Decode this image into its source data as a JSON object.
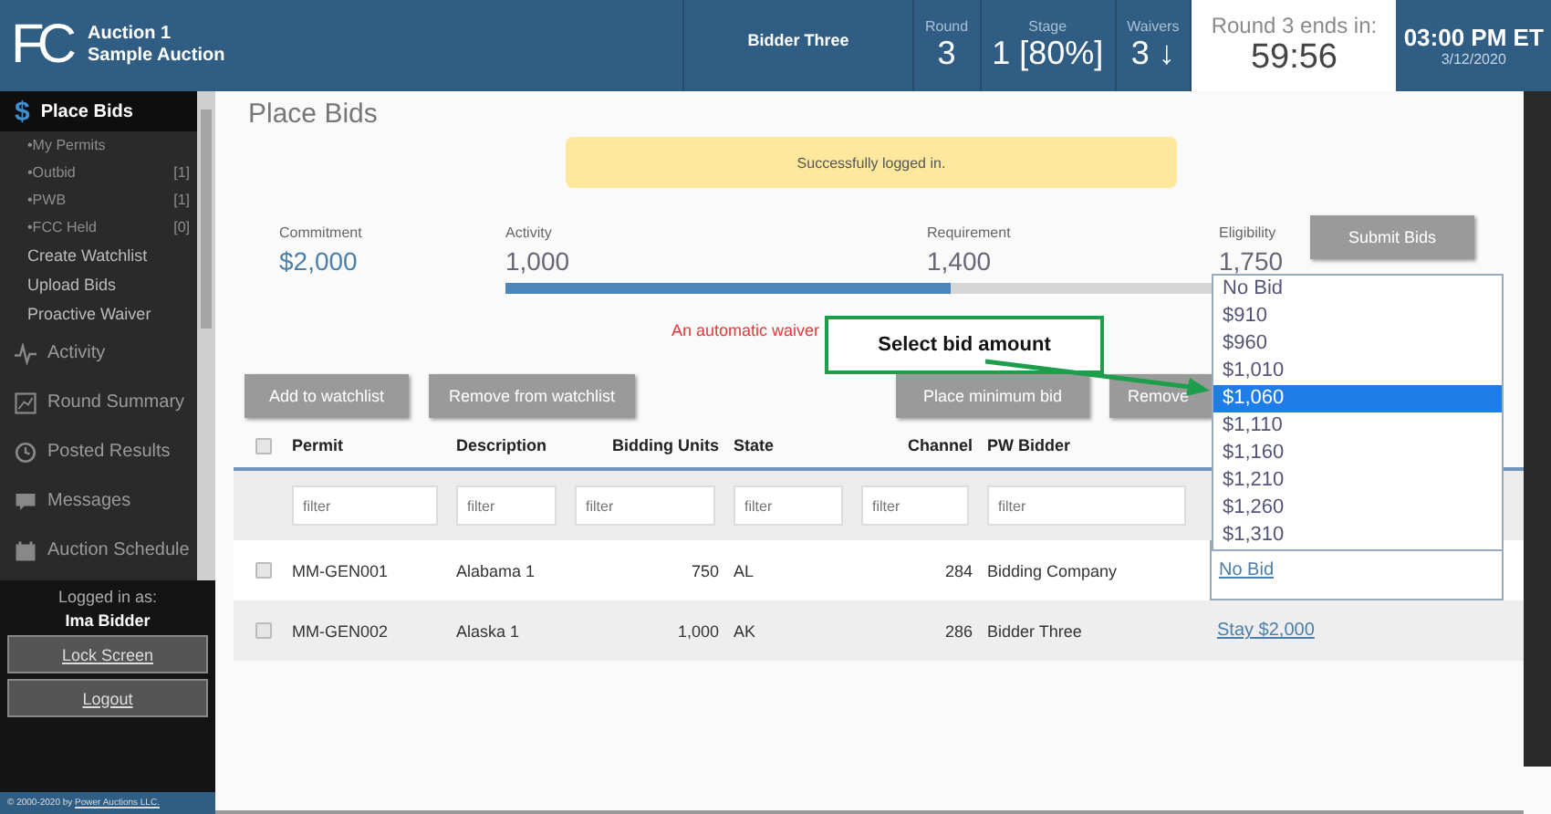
{
  "header": {
    "logo": "FC",
    "auction": "Auction 1",
    "auction_name": "Sample Auction",
    "bidder": "Bidder Three",
    "stats": [
      {
        "label": "Round",
        "value": "3"
      },
      {
        "label": "Stage",
        "value": "1 [80%]"
      },
      {
        "label": "Waivers",
        "value": "3 ↓"
      }
    ],
    "countdown": {
      "label": "Round 3 ends in:",
      "value": "59:56"
    },
    "clock": {
      "time": "03:00 PM ET",
      "date": "3/12/2020"
    }
  },
  "sidebar": {
    "items": [
      {
        "label": "Place Bids",
        "kind": "main",
        "icon": "$",
        "selected": true
      },
      {
        "label": "•My Permits",
        "kind": "sub"
      },
      {
        "label": "•Outbid",
        "kind": "sub",
        "count": "[1]"
      },
      {
        "label": "•PWB",
        "kind": "sub",
        "count": "[1]"
      },
      {
        "label": "•FCC Held",
        "kind": "sub",
        "count": "[0]"
      },
      {
        "label": "Create Watchlist",
        "kind": "link"
      },
      {
        "label": "Upload Bids",
        "kind": "link"
      },
      {
        "label": "Proactive Waiver",
        "kind": "link"
      },
      {
        "label": "Activity",
        "kind": "section"
      },
      {
        "label": "Round Summary",
        "kind": "section"
      },
      {
        "label": "Posted Results",
        "kind": "section"
      },
      {
        "label": "Messages",
        "kind": "section"
      },
      {
        "label": "Auction Schedule",
        "kind": "section"
      }
    ],
    "logged_in_label": "Logged in as:",
    "user": "Ima Bidder",
    "buttons": [
      "Lock Screen",
      "Logout"
    ],
    "footer": "© 2000-2020 by ",
    "footer_link": "Power Auctions LLC."
  },
  "page": {
    "title": "Place Bids",
    "alert": "Successfully logged in.",
    "stats": [
      {
        "label": "Commitment",
        "value": "$2,000",
        "kind": "money"
      },
      {
        "label": "Activity",
        "value": "1,000",
        "kind": "number"
      },
      {
        "label": "Requirement",
        "value": "1,400",
        "kind": "number"
      },
      {
        "label": "Eligibility",
        "value": "1,750",
        "kind": "number"
      }
    ],
    "activity_bar": {
      "level": 0.45
    },
    "submit": "Submit Bids",
    "waiver_note": "An automatic waiver",
    "buttons": [
      "Add to watchlist",
      "Remove from watchlist",
      "Place minimum bid",
      "Remove"
    ]
  },
  "table": {
    "columns": [
      "Permit",
      "Description",
      "Bidding Units",
      "State",
      "Channel",
      "PW Bidder"
    ],
    "select_all_checked": false,
    "filters": [
      {
        "placeholder": "filter"
      },
      {
        "placeholder": "filter"
      },
      {
        "placeholder": "filter"
      },
      {
        "placeholder": "filter"
      },
      {
        "placeholder": "filter"
      },
      {
        "placeholder": "filter"
      }
    ],
    "rows": [
      {
        "checked": false,
        "cells": [
          "MM-GEN001",
          "Alabama 1",
          "750",
          "AL",
          "284",
          "Bidding Company"
        ],
        "bid": "No Bid",
        "bid_open": true
      },
      {
        "checked": false,
        "cells": [
          "MM-GEN002",
          "Alaska 1",
          "1,000",
          "AK",
          "286",
          "Bidder Three"
        ],
        "bid": "Stay $2,000",
        "bid_open": false
      }
    ]
  },
  "dropdown": {
    "options": [
      {
        "label": "No Bid",
        "selected": false
      },
      {
        "label": "$910",
        "selected": false
      },
      {
        "label": "$960",
        "selected": false
      },
      {
        "label": "$1,010",
        "selected": false
      },
      {
        "label": "$1,060",
        "selected": true
      },
      {
        "label": "$1,110",
        "selected": false
      },
      {
        "label": "$1,160",
        "selected": false
      },
      {
        "label": "$1,210",
        "selected": false
      },
      {
        "label": "$1,260",
        "selected": false
      },
      {
        "label": "$1,310",
        "selected": false
      }
    ]
  },
  "callout": "Select bid amount"
}
